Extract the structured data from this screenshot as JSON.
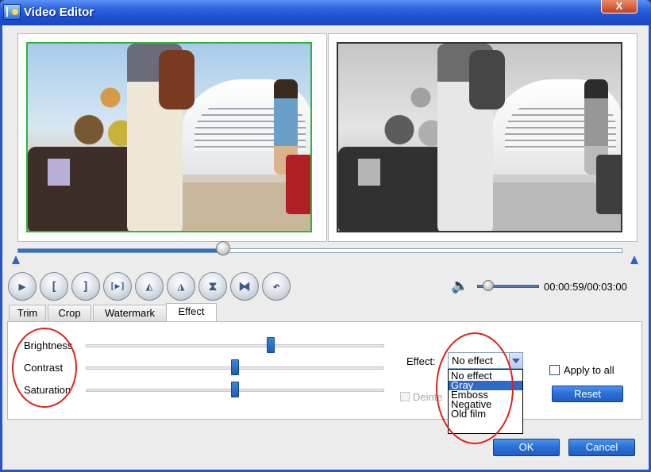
{
  "window": {
    "title": "Video Editor",
    "close_label": "X"
  },
  "player": {
    "time": "00:00:59/00:03:00",
    "seek_fraction": 0.34,
    "volume_fraction": 0.18,
    "controls": [
      {
        "name": "play-button",
        "glyph": "▶"
      },
      {
        "name": "mark-in-button",
        "glyph": "["
      },
      {
        "name": "mark-out-button",
        "glyph": "]"
      },
      {
        "name": "play-selection-button",
        "glyph": "[▶]"
      },
      {
        "name": "flip-left-button",
        "glyph": "◭"
      },
      {
        "name": "flip-right-button",
        "glyph": "◮"
      },
      {
        "name": "flip-vertical-button",
        "glyph": "⧗"
      },
      {
        "name": "flip-horizontal-button",
        "glyph": "⧓"
      },
      {
        "name": "undo-button",
        "glyph": "↶"
      }
    ]
  },
  "tabs": [
    {
      "label": "Trim",
      "active": false
    },
    {
      "label": "Crop",
      "active": false
    },
    {
      "label": "Watermark",
      "active": false
    },
    {
      "label": "Effect",
      "active": true
    }
  ],
  "effect_panel": {
    "sliders": [
      {
        "label": "Brightness",
        "value_fraction": 0.62
      },
      {
        "label": "Contrast",
        "value_fraction": 0.5
      },
      {
        "label": "Saturation",
        "value_fraction": 0.5
      }
    ],
    "effect_label": "Effect:",
    "effect_selected": "No effect",
    "effect_options": [
      "No effect",
      "Gray",
      "Emboss",
      "Negative",
      "Old film"
    ],
    "effect_highlighted": "Gray",
    "deinterlace_label": "Deinte",
    "apply_to_all_label": "Apply to all",
    "apply_to_all_checked": false,
    "reset_label": "Reset"
  },
  "footer": {
    "ok_label": "OK",
    "cancel_label": "Cancel"
  },
  "colors": {
    "titlebar": "#1e4fcf",
    "accent_blue": "#2a6fd5",
    "annotation_red": "#e0221b"
  }
}
